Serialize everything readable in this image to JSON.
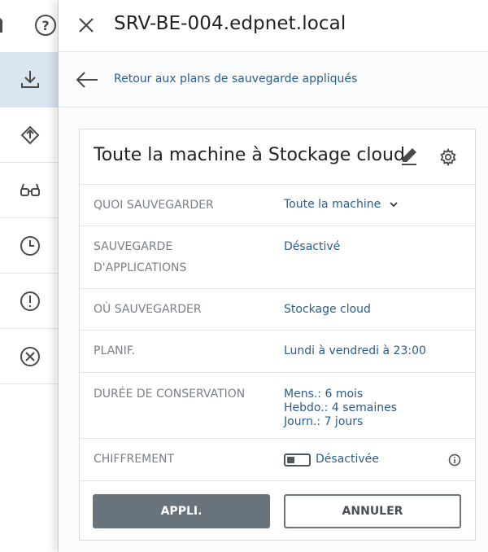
{
  "header": {
    "title": "SRV-BE-004.edpnet.local"
  },
  "nav": {
    "back_label": "Retour aux plans de sauvegarde appliqués"
  },
  "plan": {
    "title": "Toute la machine à Stockage cloud",
    "rows": [
      {
        "label": "QUOI SAUVEGARDER",
        "value": "Toute la machine"
      },
      {
        "label": "SAUVEGARDE D'APPLICATIONS",
        "value": "Désactivé"
      },
      {
        "label": "OÙ SAUVEGARDER",
        "value": "Stockage cloud"
      },
      {
        "label": "PLANIF.",
        "value": "Lundi à vendredi à 23:00"
      },
      {
        "label": "DURÉE DE CONSERVATION",
        "values": [
          "Mens.: 6 mois",
          "Hebdo.: 4 semaines",
          "Journ.: 7 jours"
        ]
      },
      {
        "label": "CHIFFREMENT",
        "value": "Désactivée"
      }
    ]
  },
  "buttons": {
    "apply": "APPLI.",
    "cancel": "ANNULER"
  },
  "rail": {
    "help_glyph": "?"
  },
  "icons": [
    "close-icon",
    "back-arrow-icon",
    "pencil-icon",
    "gear-icon",
    "chevron-down-icon",
    "info-icon",
    "help-icon",
    "backup-download-icon",
    "recovery-icon",
    "glasses-icon",
    "clock-icon",
    "alert-icon",
    "cancel-circle-icon"
  ],
  "colors": {
    "link": "#2b5d8f",
    "label": "#7b8087",
    "apply_bg": "#69737c",
    "active_rail": "#d9e4f1"
  }
}
